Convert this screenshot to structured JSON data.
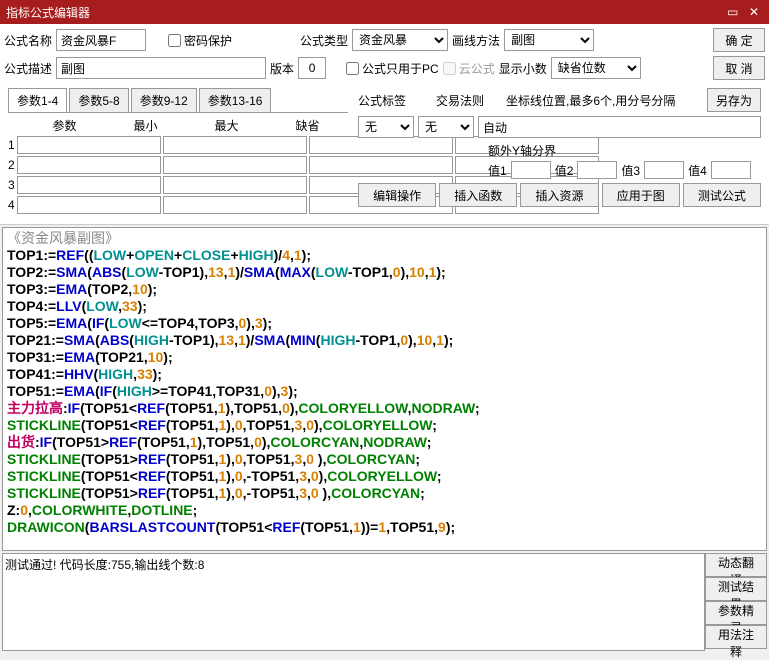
{
  "title": "指标公式编辑器",
  "labels": {
    "name": "公式名称",
    "pwd": "密码保护",
    "type": "公式类型",
    "draw": "画线方法",
    "desc": "公式描述",
    "ver": "版本",
    "pcOnly": "公式只用于PC",
    "cloud": "云公式",
    "showDec": "显示小数",
    "decPlaces": "缺省位数",
    "tag": "公式标签",
    "tradeRule": "交易法则",
    "coordHint": "坐标线位置,最多6个,用分号分隔",
    "extraY": "额外Y轴分界",
    "v1": "值1",
    "v2": "值2",
    "v3": "值3",
    "v4": "值4"
  },
  "fields": {
    "name": "资金风暴F",
    "desc": "副图",
    "ver": "0",
    "type": "资金风暴",
    "draw": "副图",
    "tag": "无",
    "rule": "无",
    "coord": "自动"
  },
  "buttons": {
    "ok": "确 定",
    "cancel": "取 消",
    "saveAs": "另存为",
    "editOp": "编辑操作",
    "insFn": "插入函数",
    "insRes": "插入资源",
    "applyChart": "应用于图",
    "testFml": "测试公式",
    "dynTrans": "动态翻译",
    "testRes": "测试结果",
    "paramWiz": "参数精灵",
    "usage": "用法注释"
  },
  "tabs": [
    "参数1-4",
    "参数5-8",
    "参数9-12",
    "参数13-16"
  ],
  "paramCols": [
    "参数",
    "最小",
    "最大",
    "缺省"
  ],
  "codeTitle": "《资金风暴副图》",
  "status": "测试通过! 代码长度:755,输出线个数:8"
}
